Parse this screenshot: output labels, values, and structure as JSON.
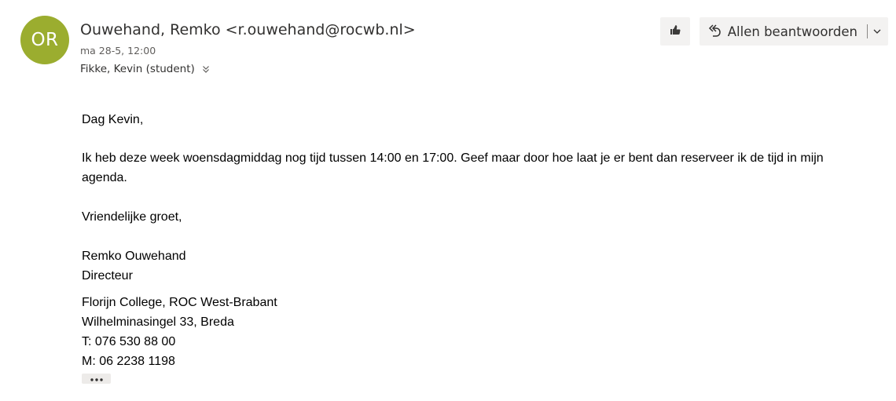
{
  "avatar": {
    "initials": "OR",
    "color": "#9bad2f"
  },
  "header": {
    "sender": "Ouwehand, Remko <r.ouwehand@rocwb.nl>",
    "date": "ma 28-5, 12:00",
    "recipients": "Fikke, Kevin (student)"
  },
  "actions": {
    "like_icon": "thumbs-up-icon",
    "reply_all_label": "Allen beantwoorden",
    "reply_icon": "reply-all-icon",
    "dropdown_icon": "chevron-down-icon"
  },
  "body": {
    "greeting": "Dag Kevin,",
    "main": "Ik heb deze week woensdagmiddag nog tijd tussen 14:00 en 17:00. Geef maar door hoe laat je er bent dan reserveer ik de tijd in mijn agenda.",
    "closing": "Vriendelijke groet,",
    "signature": {
      "name": "Remko Ouwehand",
      "title": "Directeur"
    },
    "address": {
      "org": "Florijn College, ROC West-Brabant",
      "street": "Wilhelminasingel 33, Breda",
      "phone": "T: 076 530 88 00",
      "mobile": "M: 06 2238 1198"
    }
  },
  "more": {
    "icon": "ellipsis-icon"
  }
}
